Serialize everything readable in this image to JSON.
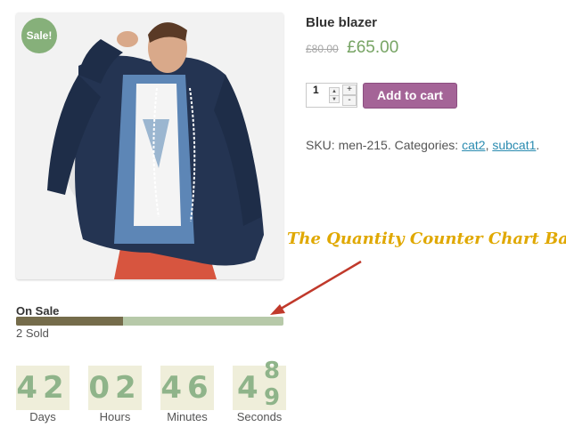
{
  "product": {
    "sale_badge": "Sale!",
    "title": "Blue blazer",
    "price_old": "£80.00",
    "price_new": "£65.00",
    "quantity": "1",
    "add_to_cart": "Add to cart",
    "sku_text": "SKU: men-215. Categories: ",
    "category_1": "cat2",
    "separator": ", ",
    "category_2": "subcat1",
    "meta_end": "."
  },
  "annotation": "The Quantity Counter Chart Bar",
  "sale_bar": {
    "label": "On Sale",
    "sold_text": "2 Sold",
    "progress_fraction": 0.4
  },
  "countdown": {
    "days": {
      "value": "42",
      "label": "Days"
    },
    "hours": {
      "value": "02",
      "label": "Hours"
    },
    "minutes": {
      "value": "46",
      "label": "Minutes"
    },
    "seconds": {
      "value_a": "4",
      "value_b": "8",
      "value_c": "9",
      "label": "Seconds"
    }
  },
  "colors": {
    "accent_button": "#a46497",
    "price": "#77a464",
    "bar_fill": "#756c4b",
    "bar_track": "#b7c9a9",
    "annotation": "#e0a800",
    "arrow": "#c0392b"
  }
}
